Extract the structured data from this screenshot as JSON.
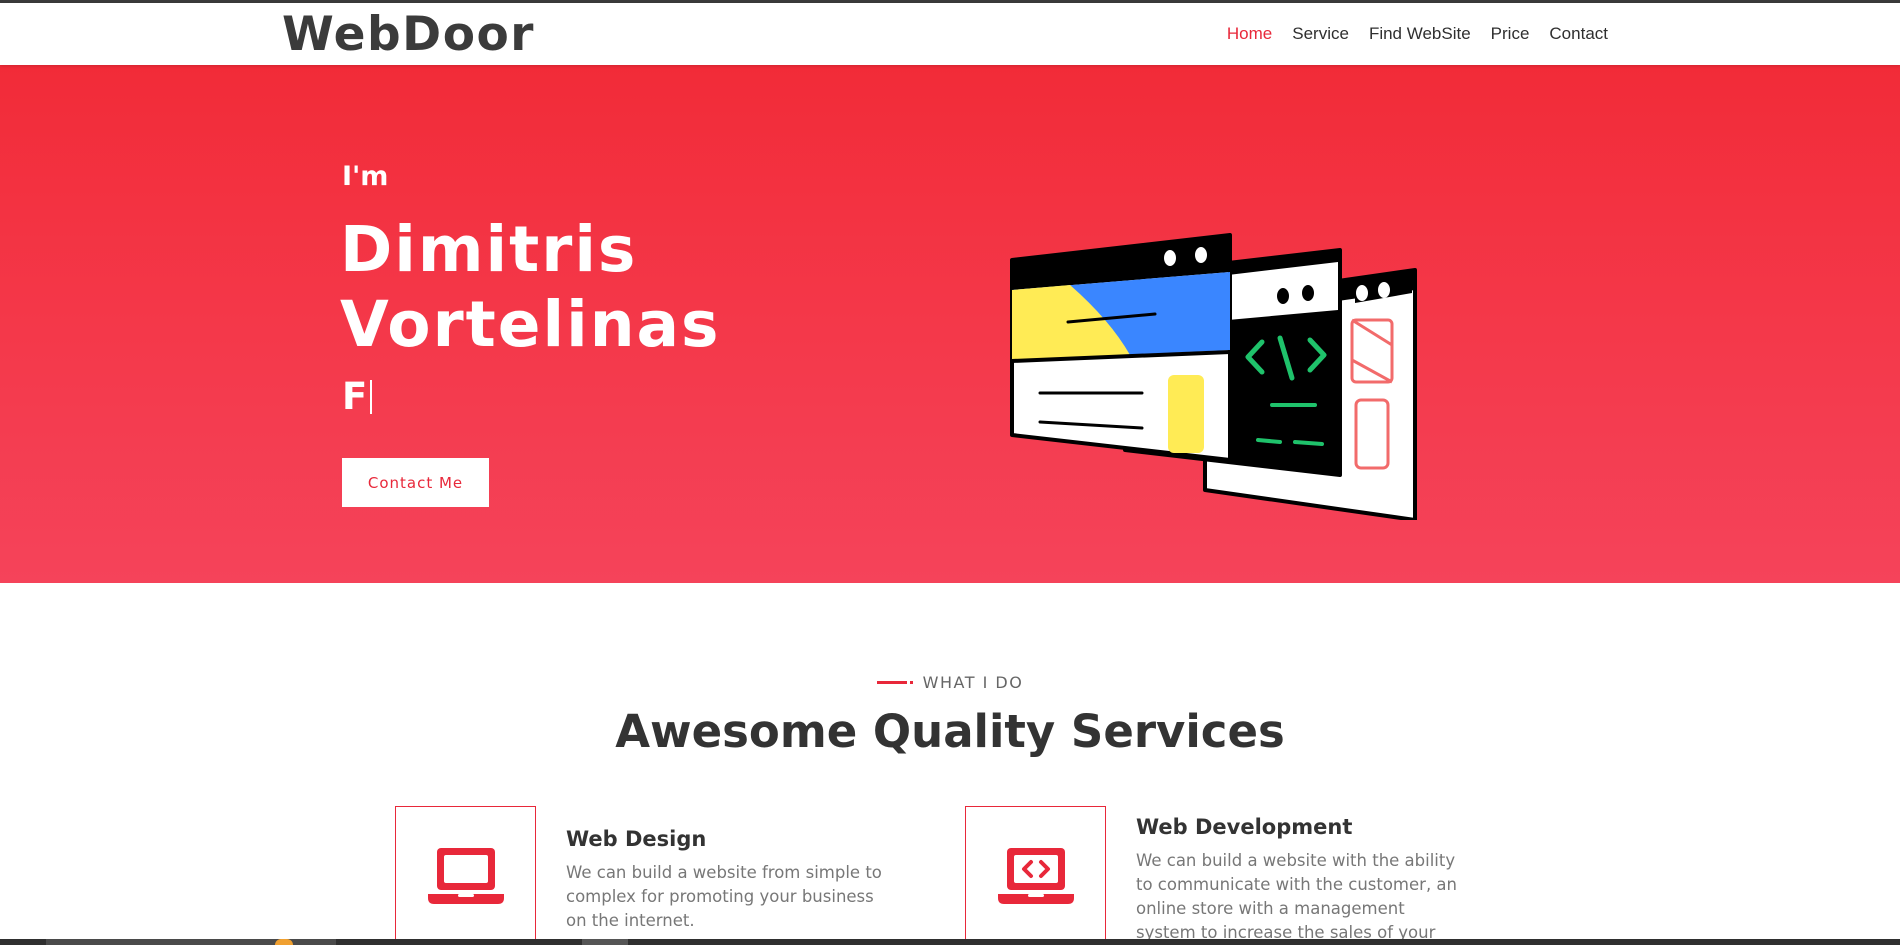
{
  "navbar": {
    "brand": "WebDoor",
    "links": [
      {
        "label": "Home",
        "active": true
      },
      {
        "label": "Service",
        "active": false
      },
      {
        "label": "Find WebSite",
        "active": false
      },
      {
        "label": "Price",
        "active": false
      },
      {
        "label": "Contact",
        "active": false
      }
    ]
  },
  "hero": {
    "intro": "I'm",
    "name": "Dimitris Vortelinas",
    "typed_text": "F",
    "cta_label": "Contact Me"
  },
  "services": {
    "eyebrow": "WHAT I DO",
    "title": "Awesome Quality Services",
    "items": [
      {
        "name": "Web Design",
        "icon": "laptop-icon",
        "description": "We can build a website from simple to complex for promoting your business on the internet."
      },
      {
        "name": "Web Development",
        "icon": "laptop-code-icon",
        "description": "We can build a website with the ability to communicate with the customer, an online store with a management system to increase the sales of your business."
      }
    ]
  },
  "colors": {
    "accent": "#e8283a",
    "hero_top": "#f22b38",
    "hero_bottom": "#f5435a",
    "text_dark": "#333333"
  }
}
